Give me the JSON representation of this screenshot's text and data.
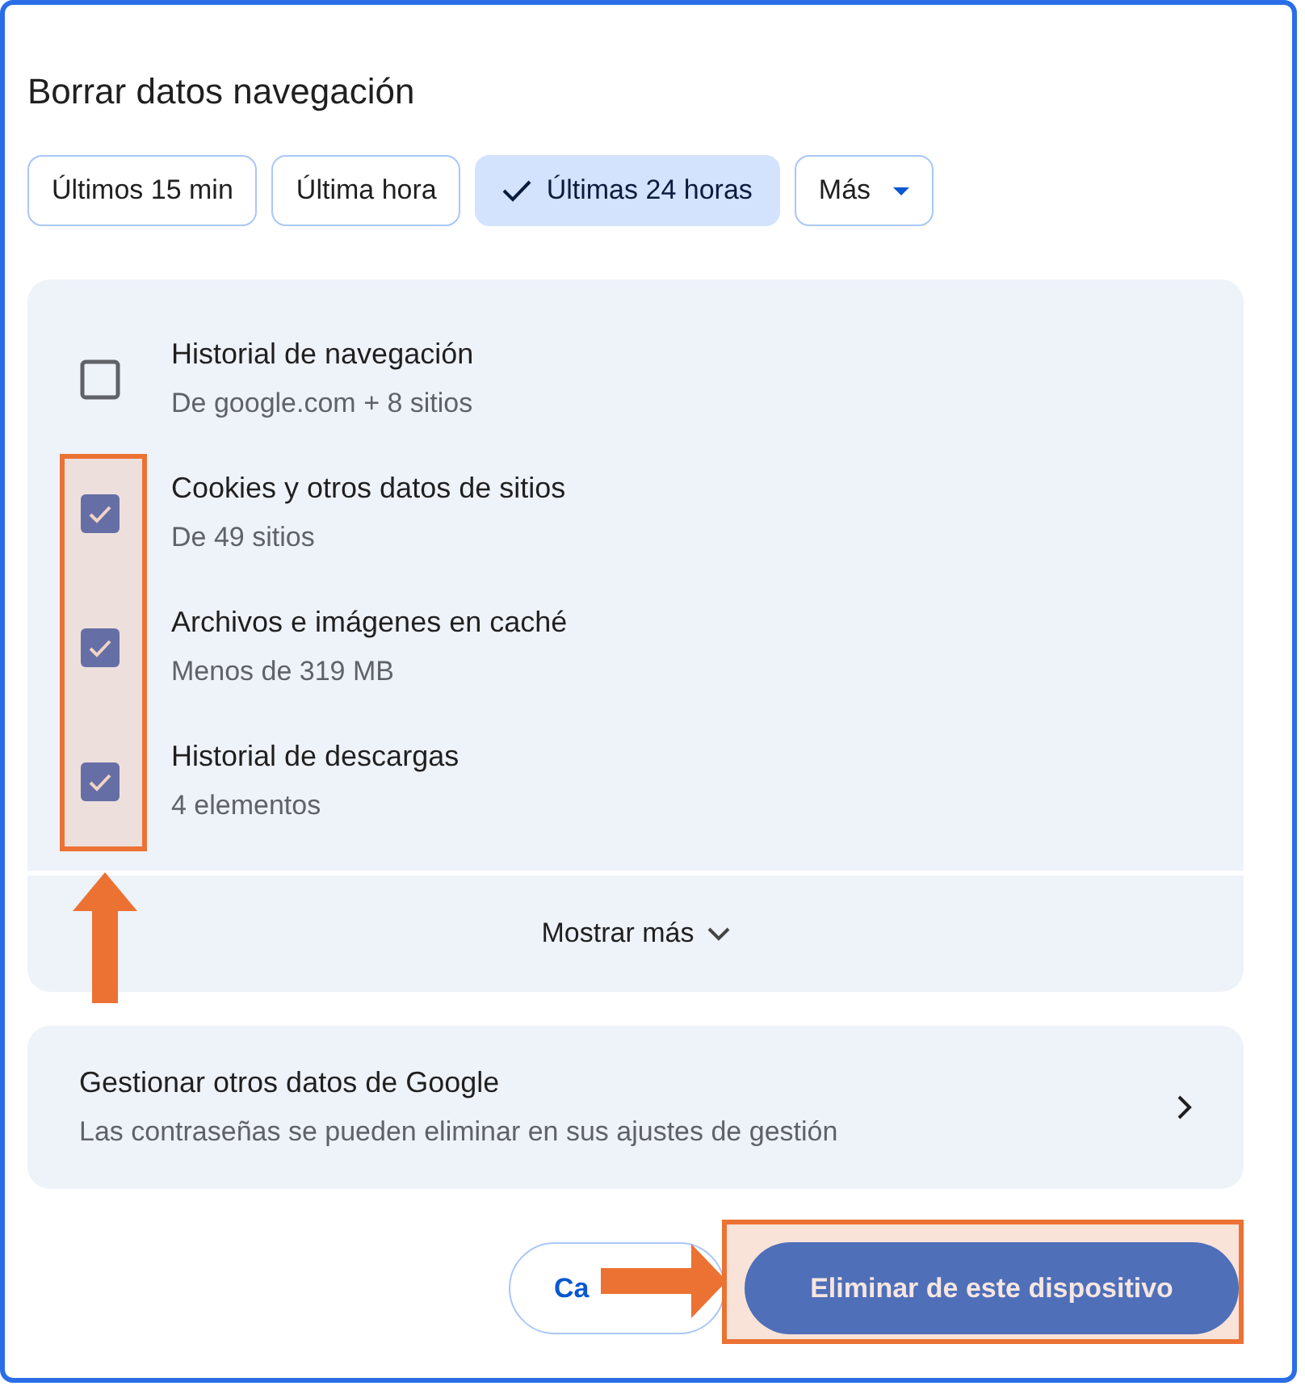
{
  "title": "Borrar datos navegación",
  "ranges": [
    {
      "label": "Últimos 15 min",
      "selected": false,
      "kind": "chip"
    },
    {
      "label": "Última hora",
      "selected": false,
      "kind": "chip"
    },
    {
      "label": "Últimas 24 horas",
      "selected": true,
      "kind": "chip"
    },
    {
      "label": "Más",
      "selected": false,
      "kind": "dropdown"
    }
  ],
  "items": [
    {
      "title": "Historial de navegación",
      "subtitle": "De google.com + 8 sitios",
      "checked": false
    },
    {
      "title": "Cookies y otros datos de sitios",
      "subtitle": "De 49 sitios",
      "checked": true
    },
    {
      "title": "Archivos e imágenes en caché",
      "subtitle": "Menos de 319 MB",
      "checked": true
    },
    {
      "title": "Historial de descargas",
      "subtitle": "4 elementos",
      "checked": true
    }
  ],
  "show_more": "Mostrar más",
  "manage": {
    "title": "Gestionar otros datos de Google",
    "subtitle": "Las contraseñas se pueden eliminar en sus ajustes de gestión"
  },
  "buttons": {
    "cancel": "Ca",
    "confirm": "Eliminar de este dispositivo"
  }
}
